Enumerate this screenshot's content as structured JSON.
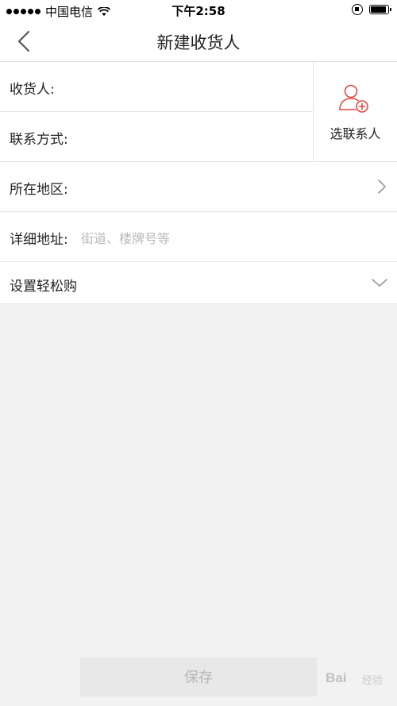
{
  "status_bar": {
    "carrier": "中国电信",
    "time": "下午2:58"
  },
  "nav": {
    "title": "新建收货人",
    "back_icon": "chevron-left-icon"
  },
  "form": {
    "receiver_label": "收货人:",
    "receiver_value": "",
    "phone_label": "联系方式:",
    "phone_value": "",
    "pick_contact_label": "选联系人",
    "pick_contact_icon": "add-contact-icon",
    "pick_contact_color": "#e8473f",
    "region_label": "所在地区:",
    "region_value": "",
    "detail_label": "详细地址:",
    "detail_value": "",
    "detail_placeholder": "街道、楼牌号等",
    "easy_buy_label": "设置轻松购"
  },
  "footer": {
    "save_label": "保存"
  },
  "watermark": {
    "text": "Bai",
    "sub": "经验"
  }
}
